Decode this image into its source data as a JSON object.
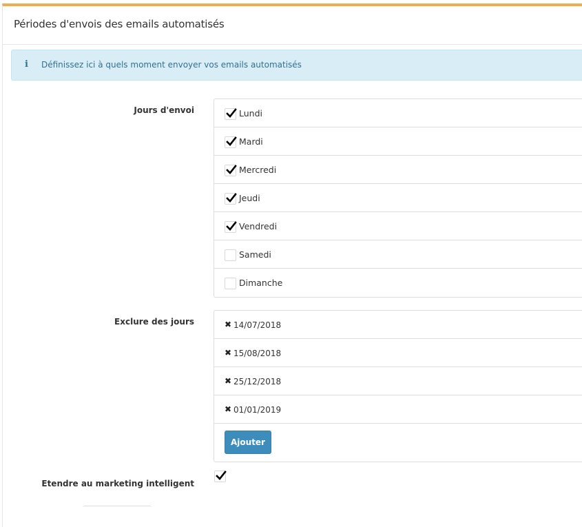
{
  "panel": {
    "title": "Périodes d'envois des emails automatisés",
    "accent_color": "#f0ad4e"
  },
  "alert": {
    "icon": "info-icon",
    "icon_glyph": "i",
    "text": "Définissez ici à quels moment envoyer vos emails automatisés",
    "color": "#31708f",
    "background": "#d9edf7"
  },
  "send_days": {
    "label": "Jours d'envoi",
    "days": [
      {
        "label": "Lundi",
        "checked": true
      },
      {
        "label": "Mardi",
        "checked": true
      },
      {
        "label": "Mercredi",
        "checked": true
      },
      {
        "label": "Jeudi",
        "checked": true
      },
      {
        "label": "Vendredi",
        "checked": true
      },
      {
        "label": "Samedi",
        "checked": false
      },
      {
        "label": "Dimanche",
        "checked": false
      }
    ]
  },
  "exclude_days": {
    "label": "Exclure des jours",
    "remove_icon": "close-icon",
    "remove_glyph": "✖",
    "dates": [
      "14/07/2018",
      "15/08/2018",
      "25/12/2018",
      "01/01/2019"
    ],
    "add_button_label": "Ajouter",
    "add_button_color": "#3c8dbc"
  },
  "smart_marketing": {
    "label": "Etendre au marketing intelligent",
    "checked": true
  }
}
